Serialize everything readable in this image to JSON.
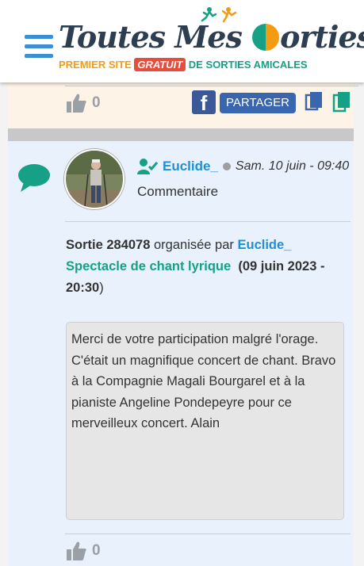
{
  "header": {
    "logo_title_part1": "Toutes Mes ",
    "logo_title_part2": "orties",
    "tagline_part1": "PREMIER SITE ",
    "tagline_badge": "GRATUIT",
    "tagline_part2": " DE SORTIES AMICALES",
    "menu_icon": "hamburger-menu-icon"
  },
  "previous_card": {
    "like_count": "0",
    "share_label": "PARTAGER",
    "icons": [
      "thumbs-up-icon",
      "facebook-icon",
      "copy-icon",
      "copy-icon"
    ]
  },
  "comment": {
    "username": "Euclide_",
    "date": "Sam. 10 juin - 09:40",
    "type": "Commentaire",
    "outing_prefix": "Sortie 284078",
    "outing_by": " organisée par ",
    "outing_organizer": "Euclide_",
    "outing_title": "Spectacle de chant lyrique",
    "outing_date": "(09 juin 2023 - 20:30",
    "outing_close": ")",
    "message": "Merci de votre participation malgré l'orage. C'était un magnifique concert de chant. Bravo à la Compagnie Magali Bourgarel et à la pianiste Angeline Pondepeyre pour ce merveilleux concert. Alain",
    "like_count": "0"
  },
  "colors": {
    "brand_blue": "#3a8fd6",
    "link_blue": "#1e8fd8",
    "green": "#16a085",
    "orange": "#f39c12",
    "card_bg": "#e8f1fc",
    "prev_card_bg": "#fdf3e7"
  }
}
